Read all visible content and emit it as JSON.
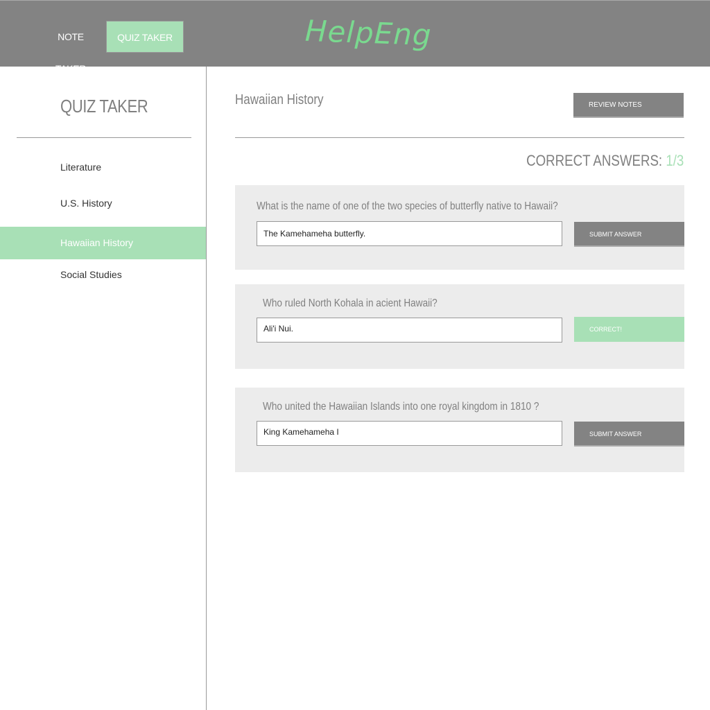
{
  "header": {
    "nav": [
      {
        "label": "NOTE TAKER"
      },
      {
        "label": "QUIZ TAKER",
        "active": true
      }
    ],
    "logo": "HelpEng"
  },
  "sidebar": {
    "title": "QUIZ TAKER",
    "items": [
      {
        "label": "Literature"
      },
      {
        "label": "U.S. History"
      },
      {
        "label": "Hawaiian History",
        "active": true
      },
      {
        "label": "Social Studies"
      }
    ]
  },
  "main": {
    "title": "Hawaiian History",
    "review_label": "REVIEW NOTES",
    "score_label": "CORRECT ANSWERS:",
    "score_value": "1/3",
    "questions": [
      {
        "question": "What is the name of one of the two species of butterfly native to Hawaii?",
        "answer": "The Kamehameha butterfly.",
        "button": "SUBMIT ANSWER"
      },
      {
        "question": "Who ruled North Kohala in acient Hawaii?",
        "answer": "Ali'i Nui.",
        "button": "CORRECT!"
      },
      {
        "question": "Who united the Hawaiian Islands into one royal kingdom in 1810 ?",
        "answer": "King Kamehameha I",
        "button": "SUBMIT ANSWER"
      }
    ]
  },
  "colors": {
    "accent": "#a8e0b6",
    "header": "#838383",
    "card": "#ececec"
  }
}
